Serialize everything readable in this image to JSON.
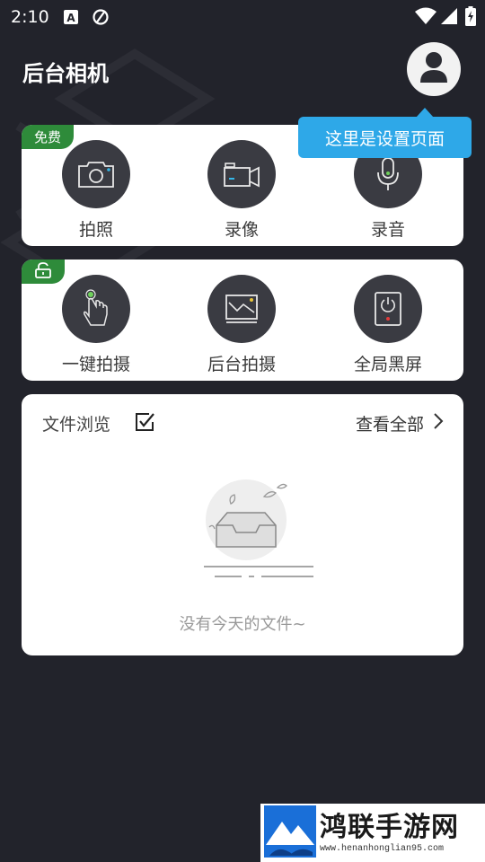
{
  "status_bar": {
    "time": "2:10",
    "icons": [
      "a-notification-icon",
      "no-sync-icon",
      "wifi-icon",
      "signal-icon",
      "battery-icon"
    ]
  },
  "header": {
    "title": "后台相机",
    "avatar_icon": "user-icon"
  },
  "tooltip": {
    "text": "这里是设置页面"
  },
  "free_card": {
    "badge": "免费",
    "items": [
      {
        "label": "拍照",
        "icon": "camera-icon"
      },
      {
        "label": "录像",
        "icon": "video-camera-icon"
      },
      {
        "label": "录音",
        "icon": "microphone-icon"
      }
    ]
  },
  "locked_card": {
    "badge_icon": "unlock-icon",
    "items": [
      {
        "label": "一键拍摄",
        "icon": "finger-tap-icon"
      },
      {
        "label": "后台拍摄",
        "icon": "picture-frame-icon"
      },
      {
        "label": "全局黑屏",
        "icon": "power-screen-icon"
      }
    ]
  },
  "files_card": {
    "title": "文件浏览",
    "select_icon": "checkbox-icon",
    "view_all": "查看全部",
    "view_all_icon": "chevron-right-icon",
    "empty_text": "没有今天的文件~"
  },
  "watermark": {
    "name": "鸿联手游网",
    "url": "www.henanhonglian95.com"
  },
  "colors": {
    "background": "#22232b",
    "card": "#ffffff",
    "badge": "#2e8b3a",
    "tooltip": "#2ea8e8",
    "icon_circle": "#3a3b42"
  }
}
